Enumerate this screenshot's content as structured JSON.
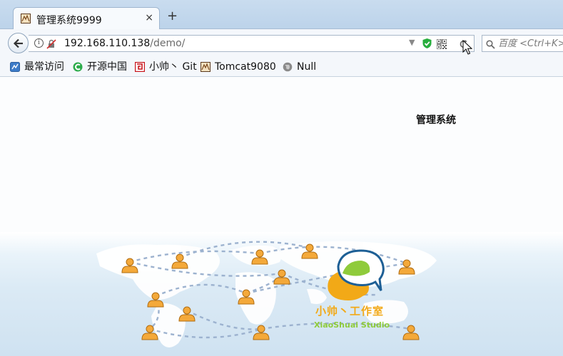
{
  "browser": {
    "tab": {
      "title": "管理系统9999",
      "close_glyph": "×"
    },
    "new_tab_glyph": "+",
    "nav": {
      "url_host": "192.168.110.138",
      "url_path": "/demo/",
      "dropdown_glyph": "▼"
    },
    "search": {
      "placeholder": "百度 <Ctrl+K>"
    },
    "bookmarks": [
      {
        "label": "最常访问",
        "icon": "bookmark-most-visited-icon"
      },
      {
        "label": "开源中国",
        "icon": "oschina-icon"
      },
      {
        "label": "小帅丶 Git",
        "icon": "git-icon"
      },
      {
        "label": "Tomcat9080",
        "icon": "tomcat-icon"
      },
      {
        "label": "Null",
        "icon": "globe-icon"
      }
    ]
  },
  "page": {
    "title": "管理系统",
    "studio": {
      "name": "小帅丶工作室",
      "subtitle": "XiaoShuai Studio"
    }
  },
  "colors": {
    "studio_orange": "#f2a917",
    "studio_green": "#8fcb3b",
    "studio_blue": "#1d5f95",
    "person_orange": "#f4a93a"
  }
}
